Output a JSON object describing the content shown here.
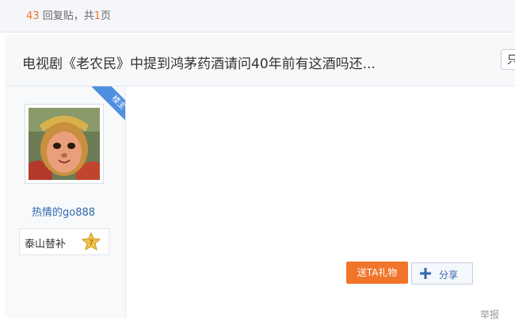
{
  "header": {
    "reply_count": "43",
    "reply_label": "回复贴，共",
    "page_count": "1",
    "page_suffix": "页"
  },
  "thread": {
    "title": "电视剧《老农民》中提到鸿茅药酒请问40年前有这酒吗还...",
    "only_button_label": "只"
  },
  "post": {
    "author_badge": "楼主",
    "username": "热情的go888",
    "level_name": "泰山替补",
    "level_number": "7",
    "gift_button_label": "送TA礼物",
    "share_button_label": "分享",
    "report_label": "举报"
  },
  "colors": {
    "accent_orange": "#f0752a",
    "link_blue": "#3366aa",
    "ribbon_blue": "#4f8fe0"
  },
  "icons": {
    "share": "plus-icon",
    "level": "star-badge-icon"
  }
}
